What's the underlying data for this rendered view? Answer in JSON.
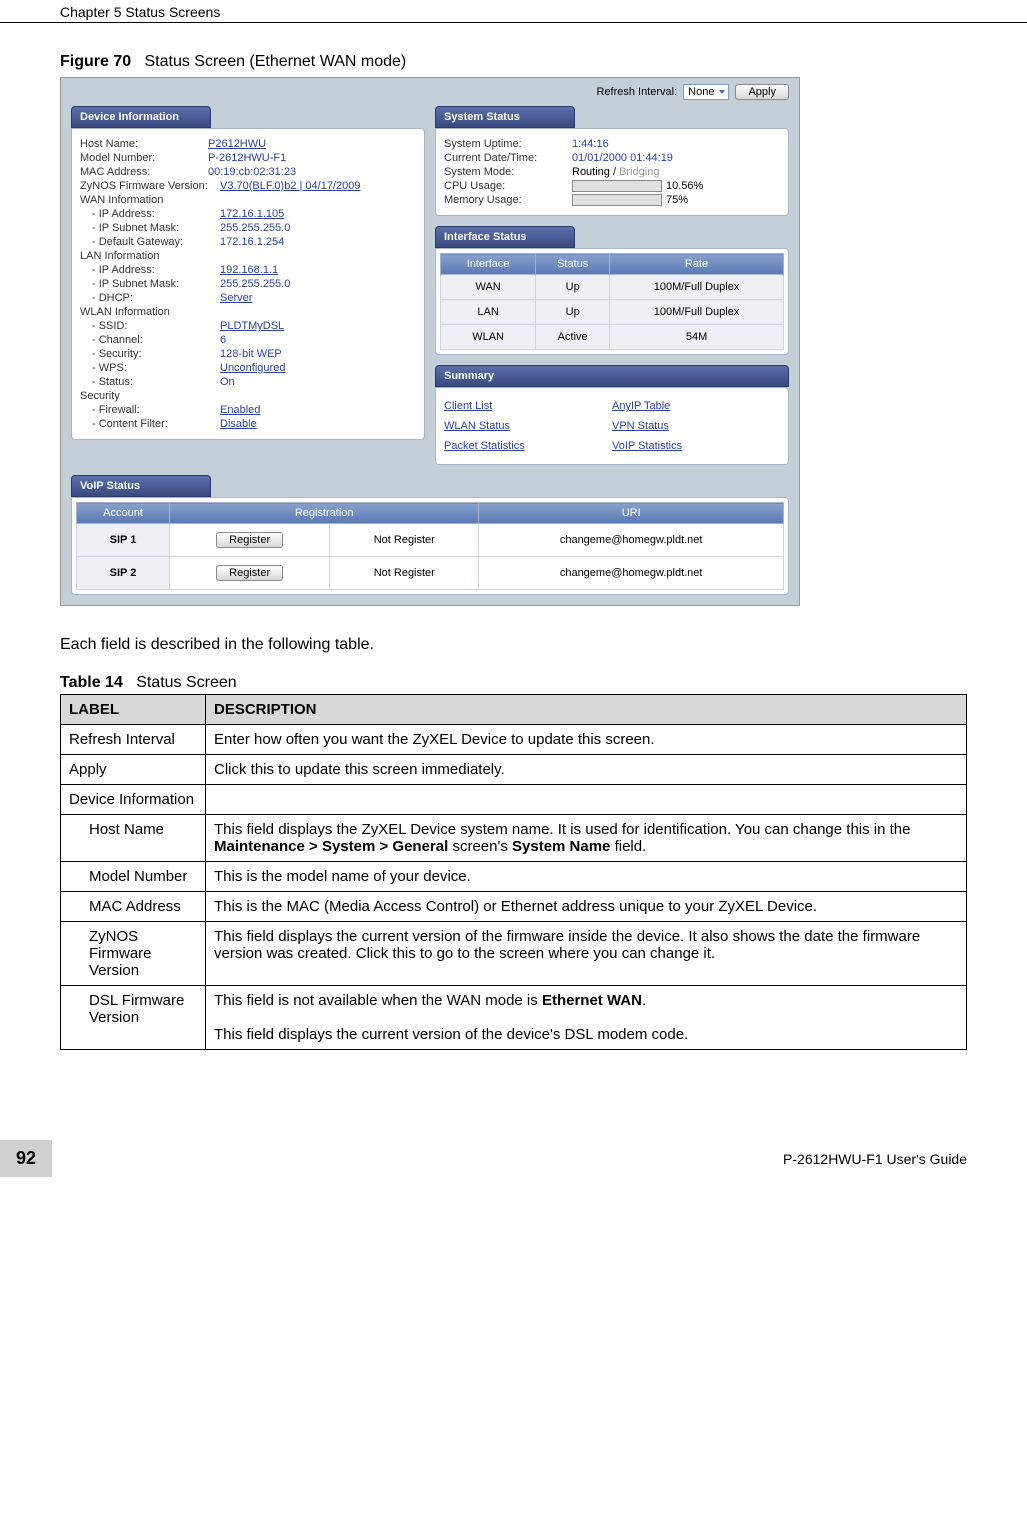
{
  "header": {
    "left": "Chapter 5 Status Screens"
  },
  "figure": {
    "label": "Figure 70",
    "caption": "Status Screen (Ethernet WAN mode)"
  },
  "ss": {
    "refresh_label": "Refresh Interval:",
    "refresh_value": "None",
    "apply_label": "Apply",
    "dev_info_header": "Device Information",
    "dev": {
      "host_name_l": "Host Name:",
      "host_name_v": "P2612HWU",
      "model_l": "Model Number:",
      "model_v": "P-2612HWU-F1",
      "mac_l": "MAC Address:",
      "mac_v": "00:19:cb:02:31:23",
      "fw_l": "ZyNOS Firmware Version:",
      "fw_v": "V3.70(BLF.0)b2 | 04/17/2009",
      "wan_l": "WAN Information",
      "wan_ip_l": "- IP Address:",
      "wan_ip_v": "172.16.1.105",
      "wan_sub_l": "- IP Subnet Mask:",
      "wan_sub_v": "255.255.255.0",
      "wan_gw_l": "- Default Gateway:",
      "wan_gw_v": "172.16.1.254",
      "lan_l": "LAN Information",
      "lan_ip_l": "- IP Address:",
      "lan_ip_v": "192.168.1.1",
      "lan_sub_l": "- IP Subnet Mask:",
      "lan_sub_v": "255.255.255.0",
      "lan_dhcp_l": "- DHCP:",
      "lan_dhcp_v": "Server",
      "wlan_l": "WLAN Information",
      "ssid_l": "- SSID:",
      "ssid_v": "PLDTMyDSL",
      "ch_l": "- Channel:",
      "ch_v": "6",
      "sec_l": "- Security:",
      "sec_v": "128-bit WEP",
      "wps_l": "- WPS:",
      "wps_v": "Unconfigured",
      "stat_l": "- Status:",
      "stat_v": "On",
      "secu_l": "Security",
      "fw2_l": "- Firewall:",
      "fw2_v": "Enabled",
      "cf_l": "- Content Filter:",
      "cf_v": "Disable"
    },
    "sys_header": "System Status",
    "sys": {
      "up_l": "System Uptime:",
      "up_v": "1:44:16",
      "dt_l": "Current Date/Time:",
      "dt_v": "01/01/2000 01:44:19",
      "mode_l": "System Mode:",
      "mode_v1": "Routing / ",
      "mode_v2": "Bridging",
      "cpu_l": "CPU Usage:",
      "cpu_v": "10.56%",
      "cpu_pct": 10.56,
      "mem_l": "Memory Usage:",
      "mem_v": "75%",
      "mem_pct": 75
    },
    "int_header": "Interface Status",
    "int_cols": {
      "c1": "Interface",
      "c2": "Status",
      "c3": "Rate"
    },
    "int_rows": [
      {
        "i": "WAN",
        "s": "Up",
        "r": "100M/Full Duplex"
      },
      {
        "i": "LAN",
        "s": "Up",
        "r": "100M/Full Duplex"
      },
      {
        "i": "WLAN",
        "s": "Active",
        "r": "54M"
      }
    ],
    "sum_header": "Summary",
    "sum_links": {
      "a1": "Client List",
      "a2": "AnyIP Table",
      "b1": "WLAN Status",
      "b2": "VPN Status",
      "c1": "Packet Statistics",
      "c2": "VoIP Statistics"
    },
    "voip_header": "VoIP Status",
    "voip_cols": {
      "c1": "Account",
      "c2": "Registration",
      "c3": "URI"
    },
    "voip_rows": [
      {
        "a": "SIP 1",
        "r": "Not Register",
        "u": "changeme@homegw.pldt.net",
        "btn": "Register"
      },
      {
        "a": "SIP 2",
        "r": "Not Register",
        "u": "changeme@homegw.pldt.net",
        "btn": "Register"
      }
    ]
  },
  "intro_text": "Each field is described in the following table.",
  "table_caption": {
    "label": "Table 14",
    "caption": "Status Screen"
  },
  "table": {
    "h1": "LABEL",
    "h2": "DESCRIPTION",
    "rows": [
      {
        "l": "Refresh Interval",
        "d": "Enter how often you want the ZyXEL Device to update this screen."
      },
      {
        "l": "Apply",
        "d": "Click this to update this screen immediately."
      },
      {
        "l": "Device Information",
        "d": ""
      },
      {
        "l": "Host Name",
        "sub": true,
        "d": "This field displays the ZyXEL Device system name. It is used for identification. You can change this in the Maintenance > System > General screen's System Name field.",
        "bold": [
          "Maintenance > System > General",
          "System Name"
        ]
      },
      {
        "l": "Model Number",
        "sub": true,
        "d": "This is the model name of your device."
      },
      {
        "l": "MAC Address",
        "sub": true,
        "d": "This is the MAC (Media Access Control) or Ethernet address unique to your ZyXEL Device."
      },
      {
        "l": "ZyNOS Firmware Version",
        "sub": true,
        "d": "This field displays the current version of the firmware inside the device. It also shows the date the firmware version was created. Click this to go to the screen where you can change it."
      },
      {
        "l": "DSL Firmware Version",
        "sub": true,
        "d_html": "This field is not available when the WAN mode is <b>Ethernet WAN</b>.<br><br>This field displays the current version of the device's DSL modem code."
      }
    ]
  },
  "footer": {
    "page": "92",
    "guide": "P-2612HWU-F1 User's Guide"
  }
}
